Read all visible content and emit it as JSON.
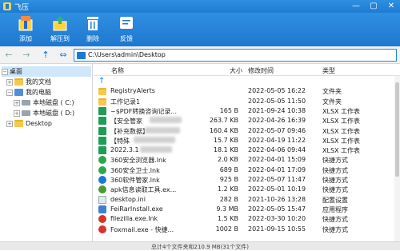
{
  "app": {
    "title": "飞压"
  },
  "window_controls": {
    "min": "—",
    "max": "▢",
    "close": "✕"
  },
  "toolbar": {
    "add": "添加",
    "extract": "解压到",
    "delete": "删除",
    "feedback": "反馈"
  },
  "address": {
    "path": "C:\\Users\\admin\\Desktop"
  },
  "tree": {
    "desktop": "桌面",
    "docs": "我的文档",
    "pc": "我的电脑",
    "c_drive": "本地磁盘 ( C:)",
    "d_drive": "本地磁盘 ( D:)",
    "desktop2": "Desktop"
  },
  "columns": {
    "name": "名称",
    "size": "大小",
    "date": "修改时间",
    "type": "类型"
  },
  "files": [
    {
      "name": "",
      "size": "",
      "date": "",
      "type": "",
      "icon": "up-arrow-icon"
    },
    {
      "name": "RegistryAlerts",
      "size": "",
      "date": "2022-05-05 16:22",
      "type": "文件夹",
      "icon": "folder-icon"
    },
    {
      "name": "工作记录1",
      "size": "",
      "date": "2022-05-05 11:50",
      "type": "文件夹",
      "icon": "folder-icon"
    },
    {
      "name": "~$PDF转换咨询记录...",
      "size": "165 B",
      "date": "2021-09-24 10:38",
      "type": "XLSX 工作表",
      "icon": "xlsx-icon"
    },
    {
      "name": "【安全管家",
      "size": "263.7 KB",
      "date": "2022-04-26 16:39",
      "type": "XLSX 工作表",
      "icon": "xlsx-icon"
    },
    {
      "name": "【补充数据】",
      "size": "160.4 KB",
      "date": "2022-05-07 09:46",
      "type": "XLSX 工作表",
      "icon": "xlsx-icon"
    },
    {
      "name": "【特殊",
      "size": "15.7 KB",
      "date": "2022-04-19 11:22",
      "type": "XLSX 工作表",
      "icon": "xlsx-icon"
    },
    {
      "name": "2022.3.1",
      "size": "18.1 KB",
      "date": "2022-04-06 09:44",
      "type": "XLSX 工作表",
      "icon": "xlsx-icon"
    },
    {
      "name": "360安全浏览器.lnk",
      "size": "2.0 KB",
      "date": "2022-04-01 15:09",
      "type": "快捷方式",
      "icon": "browser-icon"
    },
    {
      "name": "360安全卫士.lnk",
      "size": "689 B",
      "date": "2022-04-01 17:09",
      "type": "快捷方式",
      "icon": "shield-icon"
    },
    {
      "name": "360软件管家.lnk",
      "size": "925 B",
      "date": "2022-05-07 11:47",
      "type": "快捷方式",
      "icon": "app-icon"
    },
    {
      "name": "apk信息读取工具.ex...",
      "size": "1.2 KB",
      "date": "2022-05-01 10:19",
      "type": "快捷方式",
      "icon": "tool-icon"
    },
    {
      "name": "desktop.ini",
      "size": "282 B",
      "date": "2021-10-26 13:28",
      "type": "配置设置",
      "icon": "ini-icon"
    },
    {
      "name": "FeiRarInstall.exe",
      "size": "9.3 MB",
      "date": "2022-05-05 15:47",
      "type": "应用程序",
      "icon": "installer-icon"
    },
    {
      "name": "filezilla.exe.lnk",
      "size": "1.5 KB",
      "date": "2022-03-30 10:20",
      "type": "快捷方式",
      "icon": "filezilla-icon"
    },
    {
      "name": "Foxmail.exe - 快捷...",
      "size": "1002 B",
      "date": "2021-09-15 10:55",
      "type": "快捷方式",
      "icon": "foxmail-icon"
    }
  ],
  "status": {
    "text": "总计4个文件夹和210.9 MB(31个文件)"
  }
}
